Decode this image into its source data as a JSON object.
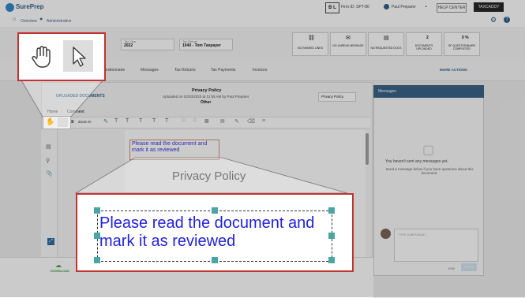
{
  "header": {
    "logo": "SurePrep",
    "badge": "B L",
    "firm_id": "Firm ID: SPT-80",
    "user": "Paul Preparer",
    "help_center": "HELP CENTER",
    "taxcaddy": "TAXCADDY"
  },
  "nav": {
    "overview": "Overview",
    "administrative": "Administrative"
  },
  "toprow": {
    "tax_year_label": "Tax Year",
    "tax_year": "2022",
    "tax_return_label": "Tax Return",
    "tax_return": "1040 - Tom Taxpayer",
    "stats": [
      {
        "value": "",
        "label": "NO SHARED LINKS"
      },
      {
        "value": "",
        "label": "NO UNREAD MESSAGE"
      },
      {
        "value": "",
        "label": "NO REQUESTED DOCS"
      },
      {
        "value": "2",
        "label": "DOCUMENTS UPLOADED"
      },
      {
        "value": "0 %",
        "label": "OF QUESTIONNAIRE COMPLETED"
      }
    ]
  },
  "tabs": {
    "questionnaire": "Questionnaire",
    "messages": "Messages",
    "tax_returns": "Tax Returns",
    "tax_payments": "Tax Payments",
    "invoices": "Invoices",
    "more_actions": "MORE ACTIONS"
  },
  "doc": {
    "back": "UPLOADED DOCUMENTS",
    "title": "Privacy Policy",
    "uploaded": "Uploaded on 02/03/2023 at 11:55 AM by Paul Preparer",
    "category": "Other",
    "selector": "Privacy Policy",
    "menu_home": "Home",
    "menu_comment": "Comment",
    "zoom": "Zoom In",
    "annotation": "Please read the document and mark it as reviewed",
    "heading": "Privacy Policy",
    "download": "DOWNLOAD"
  },
  "messages": {
    "title": "Messages",
    "empty_title": "You haven't sent any messages yet.",
    "empty_sub": "Send a message below if you have questions about this document.",
    "placeholder": "TYPE A MESSAGE...",
    "char_count": "1000",
    "send": "SEND"
  }
}
